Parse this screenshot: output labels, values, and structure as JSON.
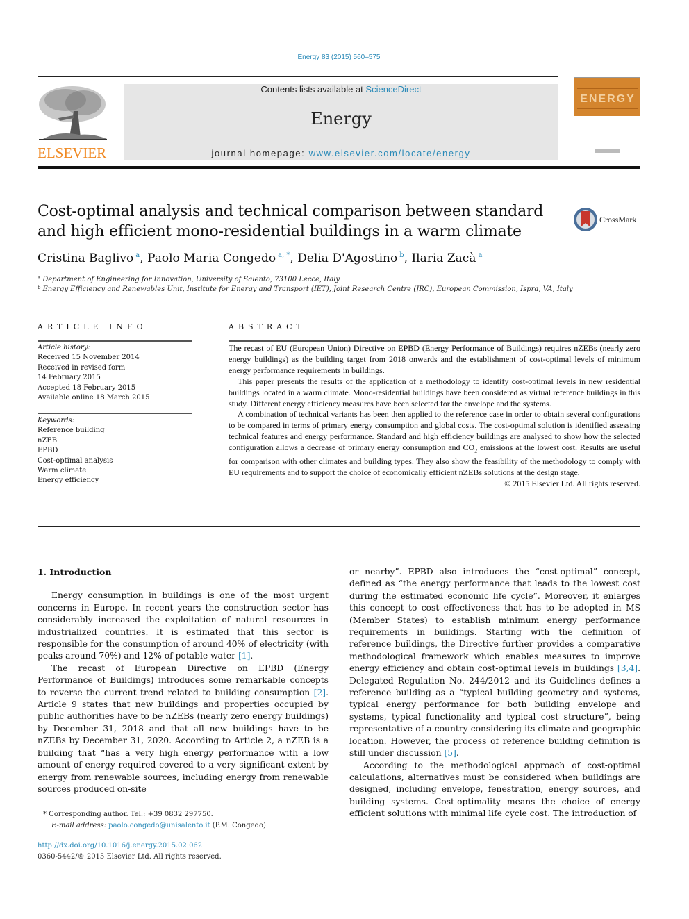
{
  "header": {
    "citation": "Energy 83 (2015) 560–575",
    "publisher_logo_text": "ELSEVIER",
    "contents_prefix": "Contents lists available at ",
    "contents_link": "ScienceDirect",
    "journal_name": "Energy",
    "homepage_prefix": "journal homepage: ",
    "homepage_link": "www.elsevier.com/locate/energy",
    "cover_title": "ENERGY",
    "crossmark_label": "CrossMark"
  },
  "article": {
    "title": "Cost-optimal analysis and technical comparison between standard and high efficient mono-residential buildings in a warm climate",
    "authors": [
      {
        "name": "Cristina Baglivo",
        "sup": "a"
      },
      {
        "name": "Paolo Maria Congedo",
        "sup": "a, *"
      },
      {
        "name": "Delia D'Agostino",
        "sup": "b"
      },
      {
        "name": "Ilaria Zacà",
        "sup": "a"
      }
    ],
    "affiliations": [
      {
        "sup": "a",
        "text": "Department of Engineering for Innovation, University of Salento, 73100 Lecce, Italy"
      },
      {
        "sup": "b",
        "text": "Energy Efficiency and Renewables Unit, Institute for Energy and Transport (IET), Joint Research Centre (JRC), European Commission, Ispra, VA, Italy"
      }
    ]
  },
  "article_info": {
    "heading": "ARTICLE INFO",
    "history_label": "Article history:",
    "history": [
      "Received 15 November 2014",
      "Received in revised form",
      "14 February 2015",
      "Accepted 18 February 2015",
      "Available online 18 March 2015"
    ],
    "keywords_label": "Keywords:",
    "keywords": [
      "Reference building",
      "nZEB",
      "EPBD",
      "Cost-optimal analysis",
      "Warm climate",
      "Energy efficiency"
    ]
  },
  "abstract": {
    "heading": "ABSTRACT",
    "p1": "The recast of EU (European Union) Directive on EPBD (Energy Performance of Buildings) requires nZEBs (nearly zero energy buildings) as the building target from 2018 onwards and the establishment of cost-optimal levels of minimum energy performance requirements in buildings.",
    "p2": "This paper presents the results of the application of a methodology to identify cost-optimal levels in new residential buildings located in a warm climate. Mono-residential buildings have been considered as virtual reference buildings in this study. Different energy efficiency measures have been selected for the envelope and the systems.",
    "p3a": "A combination of technical variants has been then applied to the reference case in order to obtain several configurations to be compared in terms of primary energy consumption and global costs. The cost-optimal solution is identified assessing technical features and energy performance. Standard and high efficiency buildings are analysed to show how the selected configuration allows a decrease of primary energy consumption and CO",
    "p3_sub": "2",
    "p3b": " emissions at the lowest cost. Results are useful for comparison with other climates and building types. They also show the feasibility of the methodology to comply with EU requirements and to support the choice of economically efficient nZEBs solutions at the design stage.",
    "copyright": "© 2015 Elsevier Ltd. All rights reserved."
  },
  "introduction": {
    "heading": "1.  Introduction",
    "p1a": "Energy consumption in buildings is one of the most urgent concerns in Europe. In recent years the construction sector has considerably increased the exploitation of natural resources in industrialized countries. It is estimated that this sector is responsible for the consumption of around 40% of electricity (with peaks around 70%) and 12% of potable water ",
    "p1_ref": "[1]",
    "p1b": ".",
    "p2a": "The recast of European Directive on EPBD (Energy Performance of Buildings) introduces some remarkable concepts to reverse the current trend related to building consumption ",
    "p2_ref": "[2]",
    "p2b": ". Article 9 states that new buildings and properties occupied by public authorities have to be nZEBs (nearly zero energy buildings) by December 31, 2018 and that all new buildings have to be nZEBs by December 31, 2020. According to Article 2, a nZEB is a building that “has a very high energy performance with a low amount of energy required covered to a very significant extent by energy from renewable sources, including energy from renewable sources produced on-site",
    "p2c": "or nearby”. EPBD also introduces the “cost-optimal” concept, defined as “the energy performance that leads to the lowest cost during the estimated economic life cycle”. Moreover, it enlarges this concept to cost effectiveness that has to be adopted in MS (Member States) to establish minimum energy performance requirements in buildings. Starting with the definition of reference buildings, the Directive further provides a comparative methodological framework which enables measures to improve energy efficiency and obtain cost-optimal levels in buildings ",
    "p2c_ref": "[3,4]",
    "p2d": ". Delegated Regulation No. 244/2012 and its Guidelines defines a reference building as a “typical building geometry and systems, typical energy performance for both building envelope and systems, typical functionality and typical cost structure”, being representative of a country considering its climate and geographic location. However, the process of reference building definition is still under discussion ",
    "p2d_ref": "[5]",
    "p2e": ".",
    "p3": "According to the methodological approach of cost-optimal calculations, alternatives must be considered when buildings are designed, including envelope, fenestration, energy sources, and building systems. Cost-optimality means the choice of energy efficient solutions with minimal life cycle cost. The introduction of"
  },
  "footnote": {
    "marker": "*",
    "corresponding": " Corresponding author. Tel.: +39 0832 297750.",
    "email_label": "E-mail address: ",
    "email": "paolo.congedo@unisalento.it",
    "email_suffix": " (P.M. Congedo).",
    "doi": "http://dx.doi.org/10.1016/j.energy.2015.02.062",
    "issn_copyright": "0360-5442/© 2015 Elsevier Ltd. All rights reserved."
  },
  "colors": {
    "link": "#2a8ab8",
    "elsevier_orange": "#f08a24",
    "masthead_bg": "#e6e6e6",
    "cover_orange": "#d4852e"
  }
}
